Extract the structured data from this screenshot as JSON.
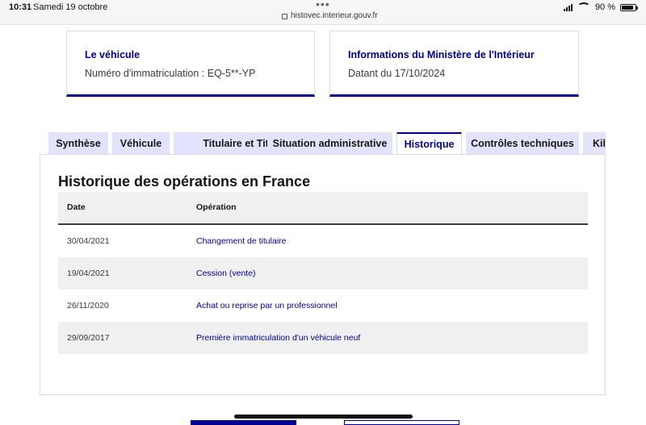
{
  "status_bar": {
    "time": "10:31",
    "date": "Samedi 19 octobre",
    "url": "histovec.interieur.gouv.fr",
    "battery": "90 %"
  },
  "cards": [
    {
      "title": "Le véhicule",
      "text": "Numéro d'immatriculation : EQ-5**-YP"
    },
    {
      "title": "Informations du Ministère de l'Intérieur",
      "text": "Datant du 17/10/2024"
    }
  ],
  "tabs": [
    {
      "label": "Synthèse"
    },
    {
      "label": "Véhicule"
    },
    {
      "label": "Titulaire et Titre"
    },
    {
      "label": "Situation administrative"
    },
    {
      "label": "Historique",
      "active": true
    },
    {
      "label": "Contrôles techniques"
    },
    {
      "label": "Kilo"
    }
  ],
  "section": {
    "title": "Historique des opérations en France",
    "columns": {
      "date": "Date",
      "operation": "Opération"
    },
    "rows": [
      {
        "date": "30/04/2021",
        "operation": "Changement de titulaire"
      },
      {
        "date": "19/04/2021",
        "operation": "Cession (vente)"
      },
      {
        "date": "26/11/2020",
        "operation": "Achat ou reprise par un professionnel"
      },
      {
        "date": "29/09/2017",
        "operation": "Première immatriculation d'un véhicule neuf"
      }
    ]
  },
  "colors": {
    "accent": "#000091",
    "tab_bg": "#e3e3fd",
    "row_alt": "#f0f0f0"
  }
}
